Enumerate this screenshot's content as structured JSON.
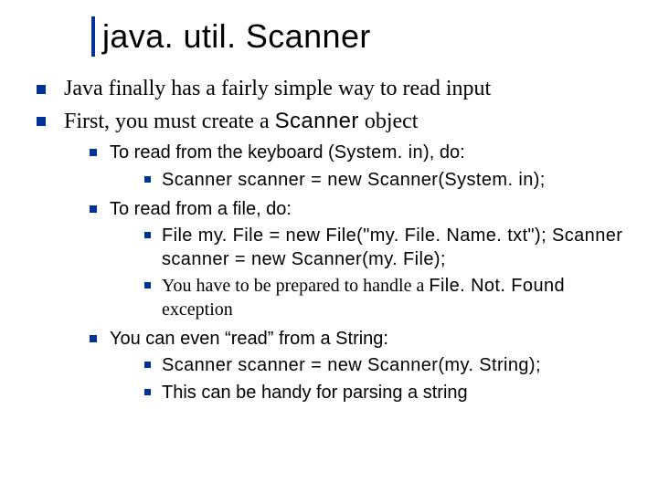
{
  "title": "java. util. Scanner",
  "bullets_lvl1": [
    "Java finally has a fairly simple way to read input",
    "First, you must create a "
  ],
  "bullets_lvl1_code_suffix": "Scanner",
  "bullets_lvl1_after_code": " object",
  "kb_intro_pre": "To read from the keyboard (",
  "kb_intro_code": "System. in",
  "kb_intro_post": "), do:",
  "kb_code": "Scanner scanner = new Scanner(System. in);",
  "file_intro": "To read from a file, do:",
  "file_code": "File my. File = new File(\"my. File. Name. txt\"); Scanner scanner = new Scanner(my. File);",
  "file_note_pre": "You have to be prepared to handle a ",
  "file_note_code": "File. Not. Found",
  "file_note_post": " exception",
  "string_intro": "You can even “read” from a String:",
  "string_code": "Scanner scanner = new Scanner(my. String);",
  "string_note": "This can be handy for parsing a string"
}
